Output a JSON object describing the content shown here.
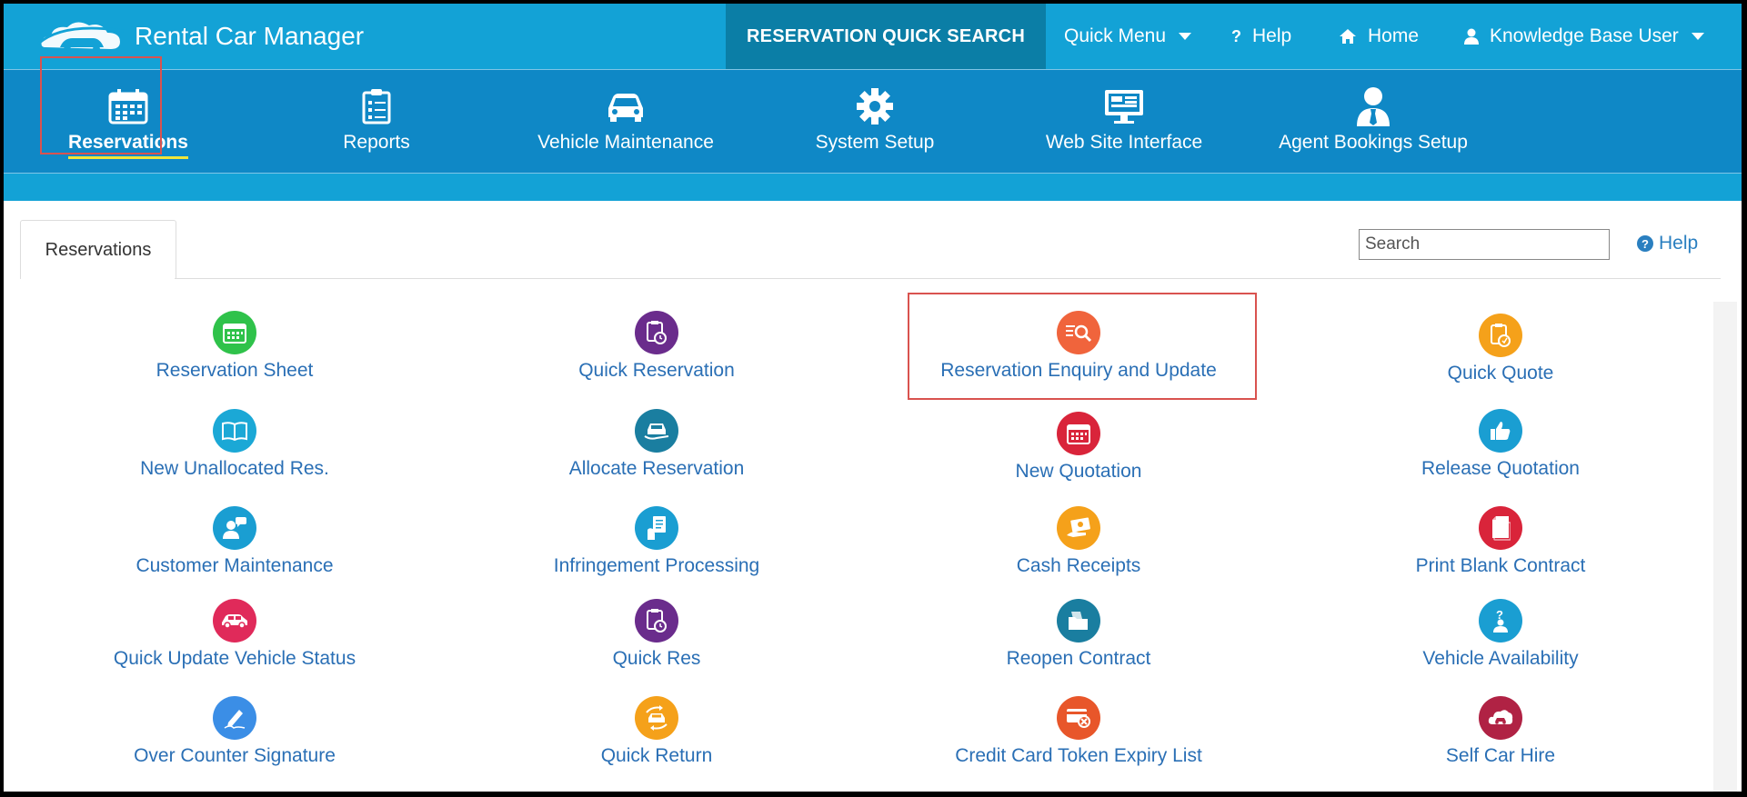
{
  "app": {
    "title": "Rental Car Manager"
  },
  "topbar": {
    "quick_search": "RESERVATION QUICK SEARCH",
    "quick_menu": "Quick Menu",
    "help": "Help",
    "home": "Home",
    "user": "Knowledge Base User"
  },
  "modules": [
    {
      "label": "Reservations",
      "icon": "calendar-icon"
    },
    {
      "label": "Reports",
      "icon": "checklist-icon"
    },
    {
      "label": "Vehicle Maintenance",
      "icon": "car-icon"
    },
    {
      "label": "System Setup",
      "icon": "gear-icon"
    },
    {
      "label": "Web Site Interface",
      "icon": "monitor-icon"
    },
    {
      "label": "Agent Bookings Setup",
      "icon": "agent-icon"
    }
  ],
  "panel": {
    "tab": "Reservations",
    "search_placeholder": "Search",
    "help": "Help"
  },
  "tiles": [
    {
      "label": "Reservation Sheet",
      "icon": "calendar-icon",
      "color": "#2fc24a"
    },
    {
      "label": "Quick Reservation",
      "icon": "stopwatch-clipboard-icon",
      "color": "#6a2c8c"
    },
    {
      "label": "Reservation Enquiry and Update",
      "icon": "search-list-icon",
      "color": "#f0643c"
    },
    {
      "label": "Quick Quote",
      "icon": "quote-clipboard-icon",
      "color": "#f5a11a"
    },
    {
      "label": "New Unallocated Res.",
      "icon": "book-icon",
      "color": "#1ba8d6"
    },
    {
      "label": "Allocate Reservation",
      "icon": "car-hand-icon",
      "color": "#1a7ea0"
    },
    {
      "label": "New Quotation",
      "icon": "calendar-icon",
      "color": "#d9243a"
    },
    {
      "label": "Release Quotation",
      "icon": "thumbs-up-icon",
      "color": "#1a9ed2"
    },
    {
      "label": "Customer Maintenance",
      "icon": "customer-chat-icon",
      "color": "#1a9ed2"
    },
    {
      "label": "Infringement Processing",
      "icon": "document-hand-icon",
      "color": "#1a9ed2"
    },
    {
      "label": "Cash Receipts",
      "icon": "cash-icon",
      "color": "#f5a11a"
    },
    {
      "label": "Print Blank Contract",
      "icon": "document-icon",
      "color": "#d9243a"
    },
    {
      "label": "Quick Update Vehicle Status",
      "icon": "car-icon",
      "color": "#e02a5a"
    },
    {
      "label": "Quick Res",
      "icon": "stopwatch-clipboard-icon",
      "color": "#6a2c8c"
    },
    {
      "label": "Reopen Contract",
      "icon": "folder-open-icon",
      "color": "#1a7ea0"
    },
    {
      "label": "Vehicle Availability",
      "icon": "question-person-icon",
      "color": "#1a9ed2"
    },
    {
      "label": "Over Counter Signature",
      "icon": "pen-icon",
      "color": "#3b8ee6"
    },
    {
      "label": "Quick Return",
      "icon": "car-return-icon",
      "color": "#f5a11a"
    },
    {
      "label": "Credit Card Token Expiry List",
      "icon": "card-cancel-icon",
      "color": "#e8562a"
    },
    {
      "label": "Self Car Hire",
      "icon": "cloud-car-icon",
      "color": "#b02244"
    }
  ]
}
